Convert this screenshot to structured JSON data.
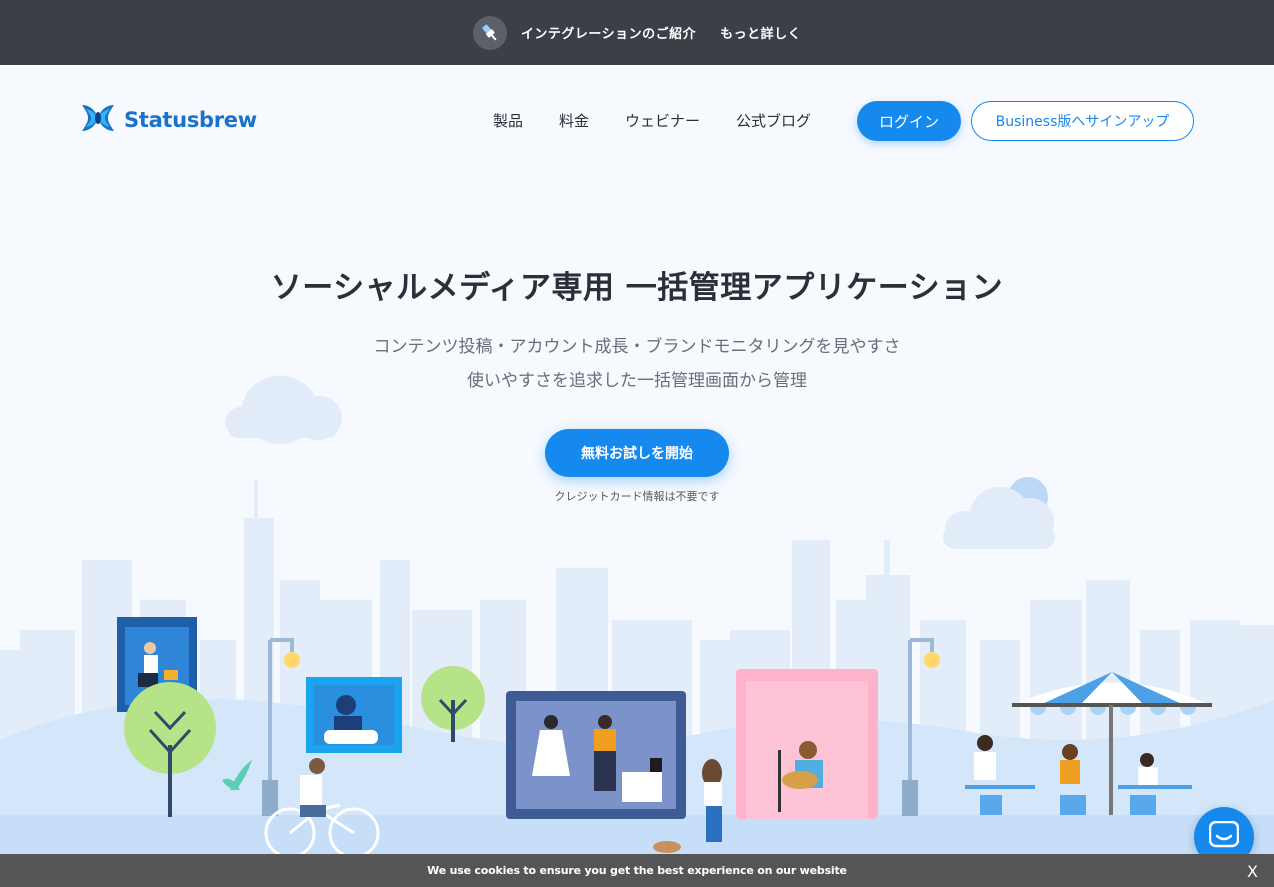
{
  "promo": {
    "text": "インテグレーションのご紹介",
    "more": "もっと詳しく"
  },
  "header": {
    "brand": "Statusbrew",
    "nav": [
      {
        "label": "製品"
      },
      {
        "label": "料金"
      },
      {
        "label": "ウェビナー"
      },
      {
        "label": "公式ブログ"
      }
    ],
    "login_label": "ログイン",
    "signup_label": "Business版へサインアップ"
  },
  "hero": {
    "title": "ソーシャルメディア専用 一括管理アプリケーション",
    "subtitle_line1": "コンテンツ投稿・アカウント成長・ブランドモニタリングを見やすさ",
    "subtitle_line2": "使いやすさを追求した一括管理画面から管理",
    "cta_label": "無料お試しを開始",
    "cta_note": "クレジットカード情報は不要です"
  },
  "cookie": {
    "text": "We use cookies to ensure you get the best experience on our website",
    "close": "X"
  },
  "icons": {
    "promo": "plug-icon",
    "logo": "butterfly-logo-icon",
    "chat": "chat-bubble-icon"
  },
  "colors": {
    "brand_blue": "#1589ee",
    "promo_bar": "#3c3f46",
    "cookie_bar": "#555557",
    "page_bg": "#f6f9fe"
  }
}
